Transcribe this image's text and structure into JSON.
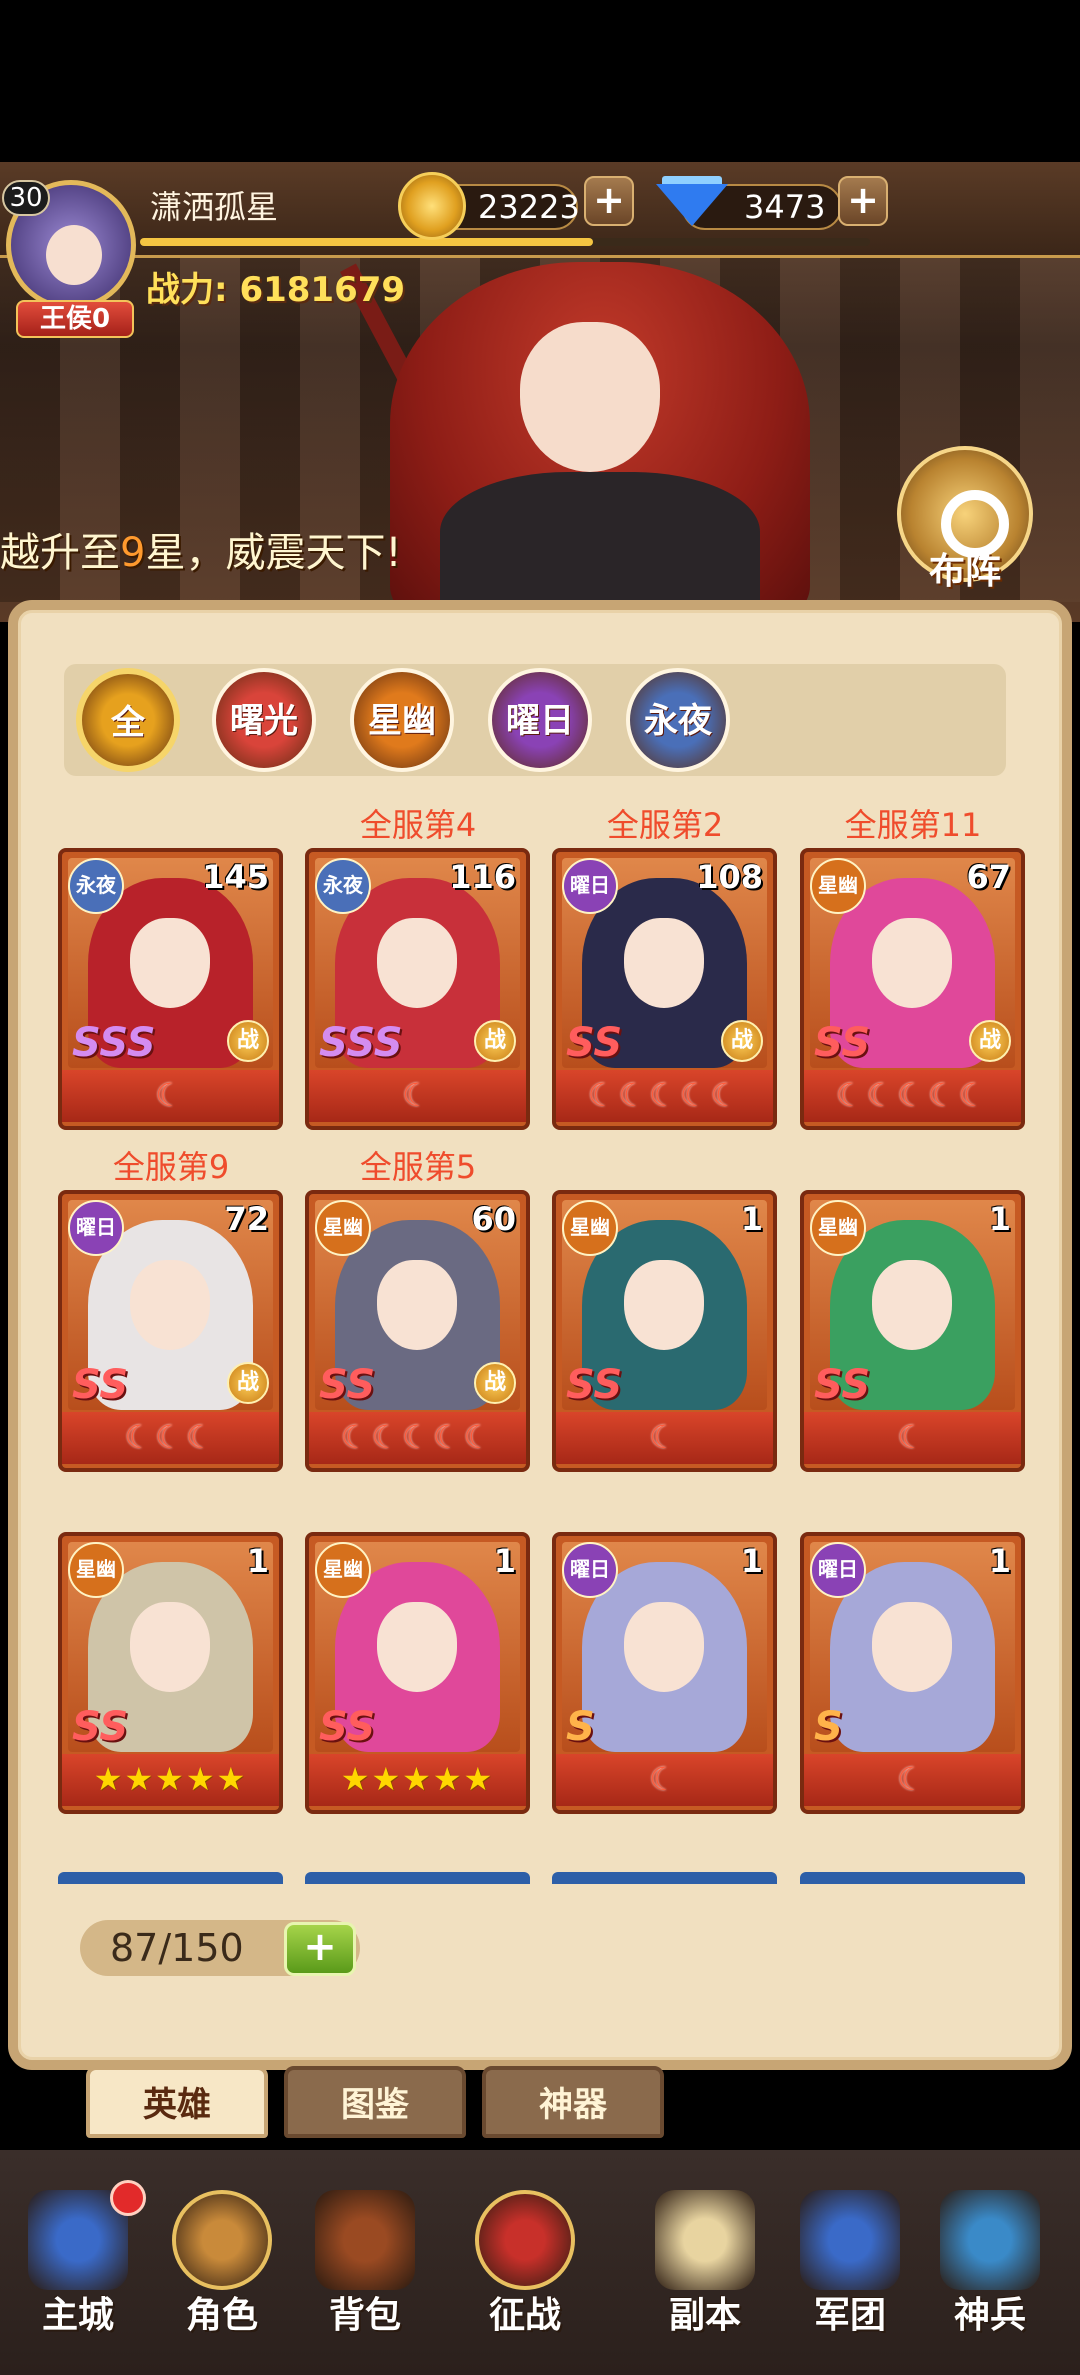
{
  "header": {
    "player_name": "潇洒孤星",
    "level": "30",
    "rank": "王侯0",
    "power_label": "战力:",
    "power_value": "6181679",
    "gold": "23223",
    "gems": "3473",
    "exp_progress": 0.62
  },
  "marquee": {
    "part1": "越升至",
    "highlight": "9",
    "part2": "星，威震天下!"
  },
  "formation_label": "布阵",
  "filters": [
    {
      "label": "全",
      "color": "#e6a11e"
    },
    {
      "label": "曙光",
      "color": "#d9443a"
    },
    {
      "label": "星幽",
      "color": "#e07a1c"
    },
    {
      "label": "曜日",
      "color": "#8a42b5"
    },
    {
      "label": "永夜",
      "color": "#4a6fb8"
    }
  ],
  "heroes": [
    {
      "faction": "永夜",
      "level": "145",
      "grade": "SSS",
      "battle": "战",
      "stars": "☾",
      "star_type": "moon",
      "rank_text": "",
      "hair": "#b8222a"
    },
    {
      "faction": "永夜",
      "level": "116",
      "grade": "SSS",
      "battle": "战",
      "stars": "☾",
      "star_type": "moon",
      "rank_text": "全服第4",
      "hair": "#c8303a"
    },
    {
      "faction": "曜日",
      "level": "108",
      "grade": "SS",
      "battle": "战",
      "stars": "☾☾☾☾☾",
      "star_type": "moon",
      "rank_text": "全服第2",
      "hair": "#2a2a4a"
    },
    {
      "faction": "星幽",
      "level": "67",
      "grade": "SS",
      "battle": "战",
      "stars": "☾☾☾☾☾",
      "star_type": "moon",
      "rank_text": "全服第11",
      "hair": "#e0489a"
    },
    {
      "faction": "曜日",
      "level": "72",
      "grade": "SS",
      "battle": "战",
      "stars": "☾☾☾",
      "star_type": "moon",
      "rank_text": "全服第9",
      "hair": "#e8e4e4"
    },
    {
      "faction": "星幽",
      "level": "60",
      "grade": "SS",
      "battle": "战",
      "stars": "☾☾☾☾☾",
      "star_type": "moon",
      "rank_text": "全服第5",
      "hair": "#6a6a82"
    },
    {
      "faction": "星幽",
      "level": "1",
      "grade": "SS",
      "battle": "",
      "stars": "☾",
      "star_type": "moon",
      "rank_text": "",
      "hair": "#2a6a70"
    },
    {
      "faction": "星幽",
      "level": "1",
      "grade": "SS",
      "battle": "",
      "stars": "☾",
      "star_type": "moon",
      "rank_text": "",
      "hair": "#3aa060"
    },
    {
      "faction": "星幽",
      "level": "1",
      "grade": "SS",
      "battle": "",
      "stars": "★★★★★",
      "star_type": "star",
      "rank_text": "",
      "hair": "#cfc4a8"
    },
    {
      "faction": "星幽",
      "level": "1",
      "grade": "SS",
      "battle": "",
      "stars": "★★★★★",
      "star_type": "star",
      "rank_text": "",
      "hair": "#e0489a"
    },
    {
      "faction": "曜日",
      "level": "1",
      "grade": "S",
      "battle": "",
      "stars": "☾",
      "star_type": "moon",
      "rank_text": "",
      "hair": "#a6a8d8"
    },
    {
      "faction": "曜日",
      "level": "1",
      "grade": "S",
      "battle": "",
      "stars": "☾",
      "star_type": "moon",
      "rank_text": "",
      "hair": "#a6a8d8"
    }
  ],
  "capacity": "87/150",
  "tabs": [
    {
      "label": "英雄",
      "active": true
    },
    {
      "label": "图鉴",
      "active": false
    },
    {
      "label": "神器",
      "active": false
    }
  ],
  "nav": [
    {
      "label": "主城",
      "icon": "castle-icon",
      "color": "#3a6ac8"
    },
    {
      "label": "角色",
      "icon": "character-icon",
      "color": "#c98a3a"
    },
    {
      "label": "背包",
      "icon": "backpack-icon",
      "color": "#9a4a22"
    },
    {
      "label": "征战",
      "icon": "battle-icon",
      "color": "#c8302a"
    },
    {
      "label": "副本",
      "icon": "scroll-icon",
      "color": "#e8d4a0"
    },
    {
      "label": "军团",
      "icon": "legion-icon",
      "color": "#3a6ac8"
    },
    {
      "label": "神兵",
      "icon": "hammer-icon",
      "color": "#3a8ac8"
    }
  ]
}
